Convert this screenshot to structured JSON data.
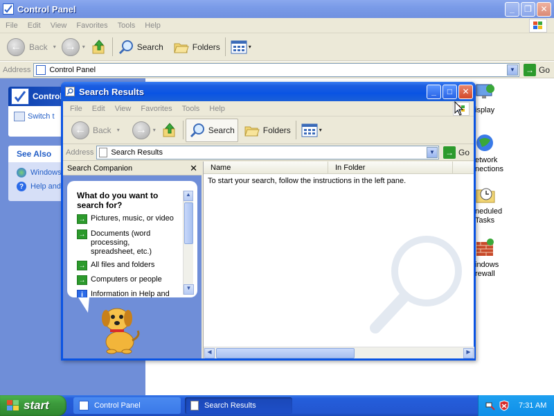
{
  "control_panel": {
    "title": "Control Panel",
    "menu": [
      "File",
      "Edit",
      "View",
      "Favorites",
      "Tools",
      "Help"
    ],
    "toolbar": {
      "back": "Back",
      "search": "Search",
      "folders": "Folders"
    },
    "address_label": "Address",
    "address_value": "Control Panel",
    "go": "Go",
    "left_panel": {
      "section_title": "Control",
      "switch_text": "Switch t",
      "see_also": "See Also",
      "links": [
        "Windows",
        "Help and"
      ]
    },
    "right_items": [
      {
        "label": "isplay",
        "icon": "display-icon"
      },
      {
        "label": "etwork\nnections",
        "icon": "network-icon"
      },
      {
        "label": "neduled\nTasks",
        "icon": "scheduled-tasks-icon"
      },
      {
        "label": "indows\nrewall",
        "icon": "firewall-icon"
      }
    ]
  },
  "search_results": {
    "title": "Search Results",
    "menu": [
      "File",
      "Edit",
      "View",
      "Favorites",
      "Tools",
      "Help"
    ],
    "toolbar": {
      "back": "Back",
      "search": "Search",
      "folders": "Folders"
    },
    "address_label": "Address",
    "address_value": "Search Results",
    "go": "Go",
    "companion_title": "Search Companion",
    "columns": [
      "Name",
      "In Folder"
    ],
    "hint": "To start your search, follow the instructions in the left pane.",
    "bubble": {
      "question": "What do you want to search for?",
      "options": [
        "Pictures, music, or video",
        "Documents (word processing, spreadsheet, etc.)",
        "All files and folders",
        "Computers or people",
        "Information in Help and"
      ]
    }
  },
  "taskbar": {
    "start": "start",
    "tasks": [
      "Control Panel",
      "Search Results"
    ],
    "time": "7:31 AM"
  },
  "colors": {
    "xp_blue": "#0a54e3",
    "taskbar": "#245edb",
    "start_green": "#3c9a3c",
    "tray": "#0f8fe8",
    "side_panel": "#6f8ed8"
  }
}
